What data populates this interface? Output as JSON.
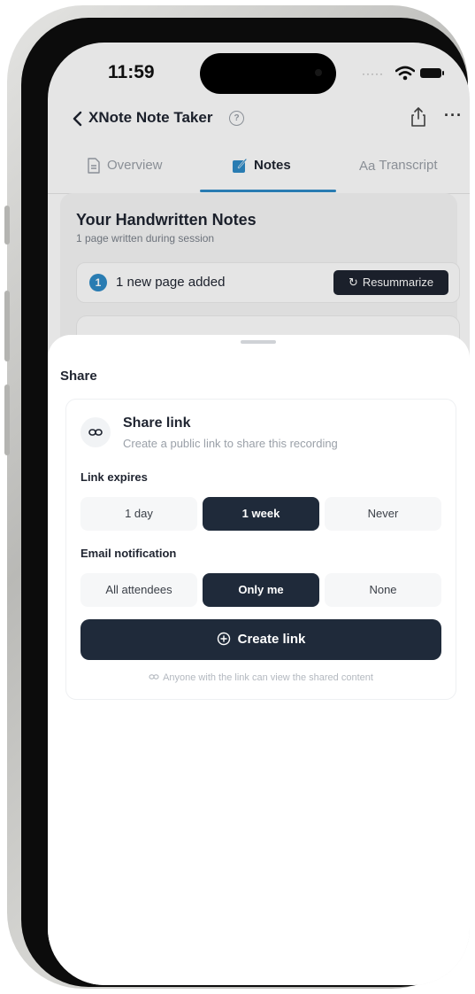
{
  "status_bar": {
    "time": "11:59"
  },
  "header": {
    "back_icon": "chevron-left-icon",
    "title": "XNote Note Taker",
    "help_icon": "question-circle-icon",
    "share_icon": "share-icon",
    "more_icon": "ellipsis-icon"
  },
  "tabs": [
    {
      "label": "Overview",
      "icon": "document-icon",
      "active": false
    },
    {
      "label": "Notes",
      "icon": "pencil-icon",
      "active": true
    },
    {
      "label": "Transcript",
      "icon": "text-icon",
      "active": false
    }
  ],
  "notes_section": {
    "title": "Your Handwritten Notes",
    "subtitle": "1 page written during session",
    "banner_count": "1",
    "banner_text": "1 new page added",
    "resummarize_label": "Resummarize"
  },
  "sheet": {
    "title": "Share",
    "share_link": {
      "title": "Share link",
      "description": "Create a public link to share this recording"
    },
    "link_expires": {
      "label": "Link expires",
      "options": [
        "1 day",
        "1 week",
        "Never"
      ],
      "selected": "1 week"
    },
    "email_notification": {
      "label": "Email notification",
      "options": [
        "All attendees",
        "Only me",
        "None"
      ],
      "selected": "Only me"
    },
    "create_button_label": "Create link",
    "footnote": "Anyone with the link can view the shared content"
  },
  "colors": {
    "accent": "#2e8bc7",
    "dark": "#1f2a3a"
  }
}
